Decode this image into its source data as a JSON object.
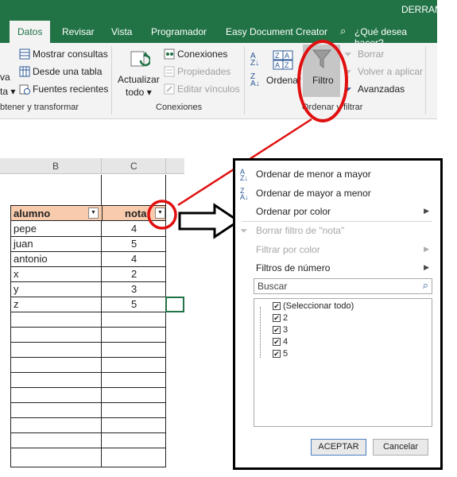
{
  "app": {
    "title_partial": "DERRAM",
    "tell_me": "¿Qué desea hacer?"
  },
  "tabs": [
    "Datos",
    "Revisar",
    "Vista",
    "Programador",
    "Easy Document Creator"
  ],
  "ribbon": {
    "get_transform": {
      "items": [
        "Mostrar consultas",
        "Desde una tabla",
        "Fuentes recientes"
      ],
      "partial_left": [
        "va",
        "ta ▾"
      ],
      "label": "btener y transformar"
    },
    "connections": {
      "refresh": [
        "Actualizar",
        "todo ▾"
      ],
      "items": [
        "Conexiones",
        "Propiedades",
        "Editar vínculos"
      ],
      "label": "Conexiones"
    },
    "sort_filter": {
      "sort_label": "Ordenar",
      "filter_label": "Filtro",
      "side": [
        "Borrar",
        "Volver a aplicar",
        "Avanzadas"
      ],
      "label": "Ordenar y filtrar"
    }
  },
  "sheet": {
    "col_headers": [
      "B",
      "C"
    ],
    "table_header": {
      "col1": "alumno",
      "col2": "nota"
    },
    "rows": [
      {
        "name": "pepe",
        "nota": "4"
      },
      {
        "name": "juan",
        "nota": "5"
      },
      {
        "name": "antonio",
        "nota": "4"
      },
      {
        "name": "x",
        "nota": "2"
      },
      {
        "name": "y",
        "nota": "3"
      },
      {
        "name": "z",
        "nota": "5"
      }
    ]
  },
  "filter_menu": {
    "items": [
      {
        "label": "Ordenar de menor a mayor",
        "enabled": true,
        "submenu": false
      },
      {
        "label": "Ordenar de mayor a menor",
        "enabled": true,
        "submenu": false
      },
      {
        "label": "Ordenar por color",
        "enabled": true,
        "submenu": true
      },
      {
        "label": "Borrar filtro de \"nota\"",
        "enabled": false,
        "submenu": false
      },
      {
        "label": "Filtrar por color",
        "enabled": false,
        "submenu": true
      },
      {
        "label": "Filtros de número",
        "enabled": true,
        "submenu": true
      }
    ],
    "search_placeholder": "Buscar",
    "checklist": [
      "(Seleccionar todo)",
      "2",
      "3",
      "4",
      "5"
    ],
    "ok_label": "ACEPTAR",
    "cancel_label": "Cancelar"
  },
  "colors": {
    "excel_green": "#217346",
    "table_header": "#f8cbad",
    "annotation_red": "#e01010"
  }
}
